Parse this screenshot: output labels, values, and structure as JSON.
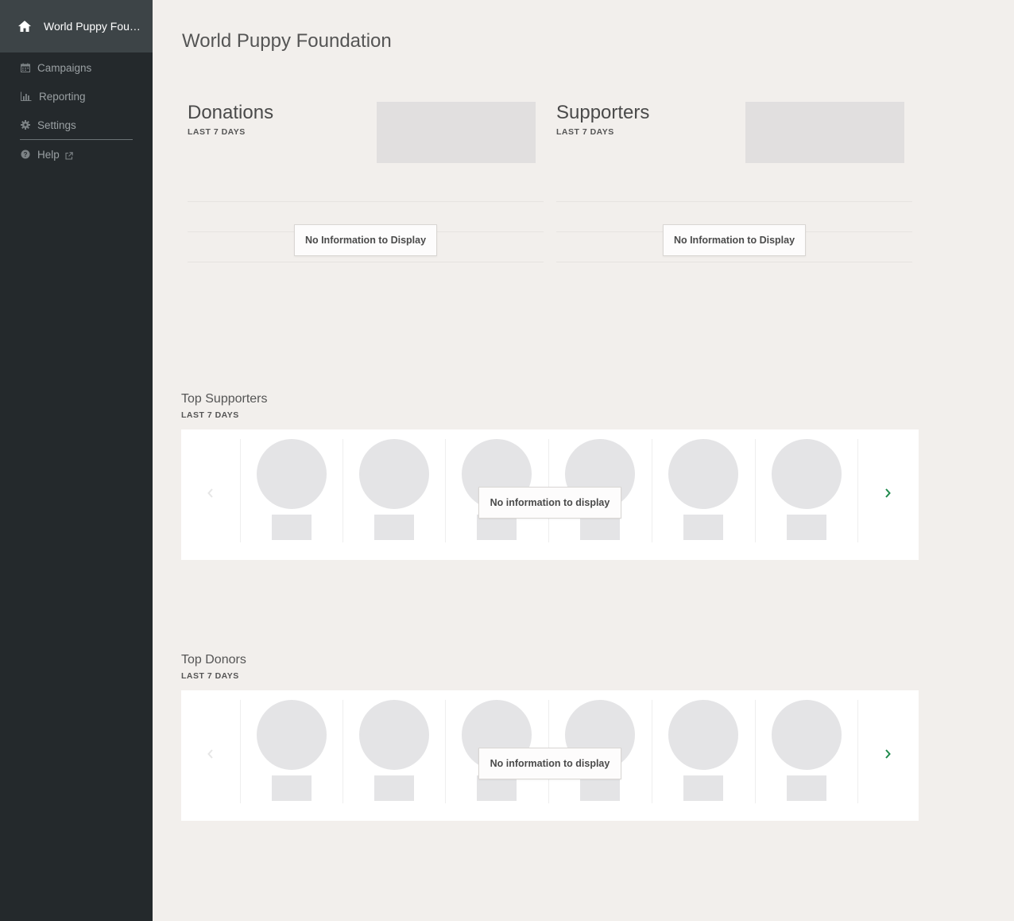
{
  "sidebar": {
    "org_name": "World Puppy Foundation",
    "items": [
      {
        "label": "Campaigns",
        "icon": "calendar-icon"
      },
      {
        "label": "Reporting",
        "icon": "bar-chart-icon"
      },
      {
        "label": "Settings",
        "icon": "gear-icon"
      },
      {
        "label": "Help",
        "icon": "question-circle-icon"
      }
    ]
  },
  "page": {
    "title": "World Puppy Foundation"
  },
  "stats": [
    {
      "title": "Donations",
      "subtitle": "LAST 7 DAYS",
      "empty_message": "No Information to Display"
    },
    {
      "title": "Supporters",
      "subtitle": "LAST 7 DAYS",
      "empty_message": "No Information to Display"
    }
  ],
  "sections": [
    {
      "title": "Top Supporters",
      "subtitle": "LAST 7 DAYS",
      "empty_message": "No information to display"
    },
    {
      "title": "Top Donors",
      "subtitle": "LAST 7 DAYS",
      "empty_message": "No information to display"
    }
  ],
  "colors": {
    "sidebar_bg": "#24292c",
    "sidebar_header_bg": "#3d4447",
    "page_bg": "#f2efec",
    "accent_green": "#1f8a4c"
  }
}
